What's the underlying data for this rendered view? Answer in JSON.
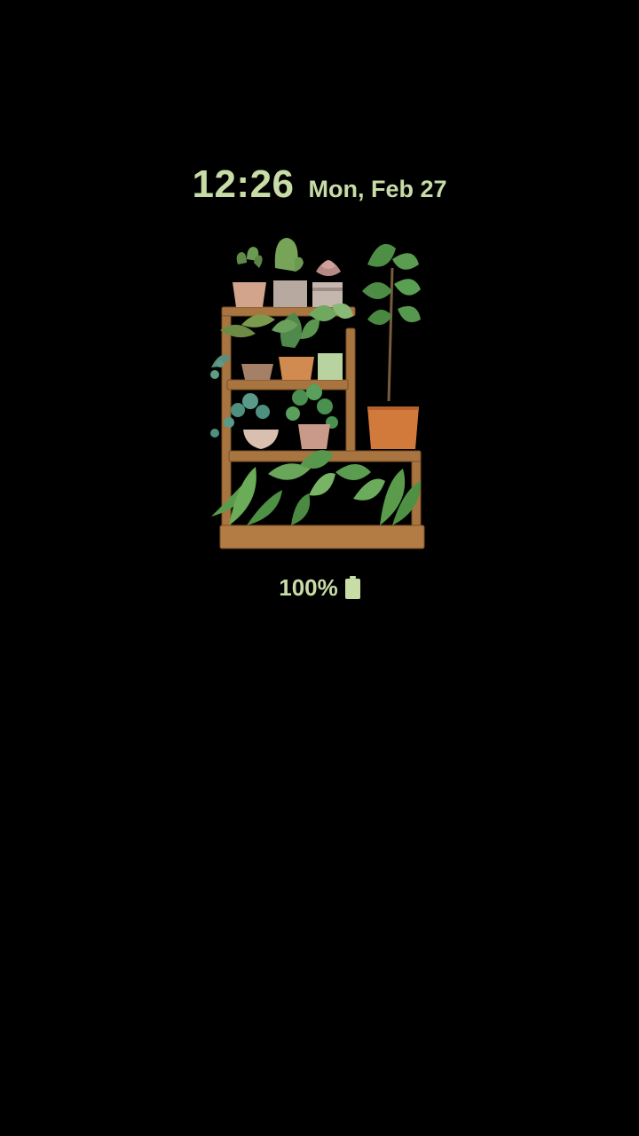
{
  "lockscreen": {
    "time": "12:26",
    "date": "Mon, Feb 27"
  },
  "wallpaper": {
    "icon": "plant-shelf-illustration"
  },
  "battery": {
    "level_text": "100%",
    "level": 1.0,
    "icon": "battery-full-icon"
  },
  "colors": {
    "background": "#000000",
    "accent": "#c8dca6"
  }
}
